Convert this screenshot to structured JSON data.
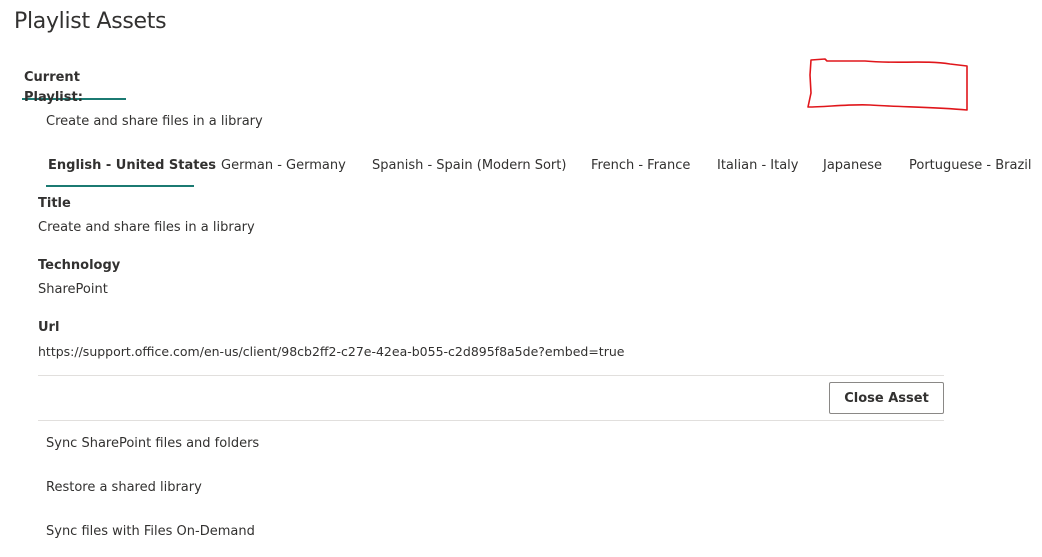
{
  "page": {
    "title": "Playlist Assets"
  },
  "current_playlist": {
    "tab_label": "Current Playlist:"
  },
  "selected_asset": {
    "name": "Create and share files in a library"
  },
  "language_tabs": [
    {
      "label": "English - United States",
      "active": true
    },
    {
      "label": "German - Germany",
      "active": false
    },
    {
      "label": "Spanish - Spain (Modern Sort)",
      "active": false
    },
    {
      "label": "French - France",
      "active": false
    },
    {
      "label": "Italian - Italy",
      "active": false
    },
    {
      "label": "Japanese",
      "active": false
    },
    {
      "label": "Portuguese - Brazil",
      "active": false
    }
  ],
  "details": {
    "title_label": "Title",
    "title_value": "Create and share files in a library",
    "technology_label": "Technology",
    "technology_value": "SharePoint",
    "url_label": "Url",
    "url_value": "https://support.office.com/en-us/client/98cb2ff2-c27e-42ea-b055-c2d895f8a5de?embed=true",
    "close_button_label": "Close Asset"
  },
  "other_assets": [
    {
      "name": "Sync SharePoint files and folders"
    },
    {
      "name": "Restore a shared library"
    },
    {
      "name": "Sync files with Files On-Demand"
    }
  ],
  "colors": {
    "accent": "#1b7a72",
    "text": "#323130",
    "divider": "#e1dfdd",
    "scribble": "#e0161b"
  },
  "icons": {
    "redaction": "red-scribble-redaction"
  }
}
